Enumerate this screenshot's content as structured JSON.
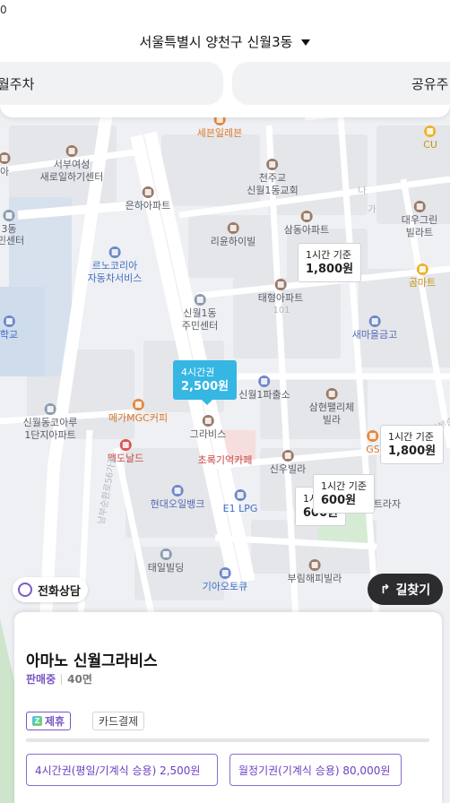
{
  "header": {
    "top_fragment": "0",
    "location": "서울특별시 양천구 신월3동",
    "chips": [
      "월주차",
      "공유주"
    ]
  },
  "map": {
    "pois": [
      {
        "name": "세븐일레븐",
        "style": "orange"
      },
      {
        "name": "CU",
        "style": "yellow"
      },
      {
        "name": "서부여성\n새로일하기센터",
        "style": "plain"
      },
      {
        "name": "천주교\n신월1동교회",
        "style": "plain"
      },
      {
        "name": "은하아파트",
        "style": "plain"
      },
      {
        "name": "삼동아파트",
        "style": "plain"
      },
      {
        "name": "대우그린\n빌라트",
        "style": "plain"
      },
      {
        "name": "리윤하이빌",
        "style": "plain"
      },
      {
        "name": "르노코리아\n자동차서비스",
        "style": "blue"
      },
      {
        "name": "곰마트",
        "style": "yellow"
      },
      {
        "name": "태형아파트",
        "style": "plain"
      },
      {
        "name": "신월1동\n주민센터",
        "style": "plain"
      },
      {
        "name": "새마을금고",
        "style": "blue"
      },
      {
        "name": "신월1파출소",
        "style": "plain"
      },
      {
        "name": "메가MGC커피",
        "style": "orange"
      },
      {
        "name": "그라비스",
        "style": "plain"
      },
      {
        "name": "삼현팰리체\n빌라",
        "style": "plain"
      },
      {
        "name": "신월동코아루\n1단지아파트",
        "style": "plain"
      },
      {
        "name": "맥도날드",
        "style": "red"
      },
      {
        "name": "초록기억카페",
        "style": "red"
      },
      {
        "name": "신우빌라",
        "style": "plain"
      },
      {
        "name": "현대오일뱅크",
        "style": "purple"
      },
      {
        "name": "E1 LPG",
        "style": "blue"
      },
      {
        "name": "태일빌딩",
        "style": "plain"
      },
      {
        "name": "기아오토큐",
        "style": "blue"
      },
      {
        "name": "부림해피빌라",
        "style": "plain"
      },
      {
        "name": "3동",
        "style": "plain"
      },
      {
        "name": "민센터",
        "style": "plain"
      },
      {
        "name": "학교",
        "style": "blue"
      },
      {
        "name": "아",
        "style": "plain"
      },
      {
        "name": "GS",
        "style": "orange"
      },
      {
        "name": "트라자",
        "style": "plain"
      },
      {
        "name": "101",
        "style": "light"
      },
      {
        "name": "나",
        "style": "light"
      },
      {
        "name": "가",
        "style": "light"
      },
      {
        "name": "남부순환로56가길",
        "style": "light"
      },
      {
        "name": "남부순환로57가길",
        "style": "light"
      }
    ],
    "price_tips": [
      {
        "label": "1시간 기준",
        "price": "1,800원",
        "active": false
      },
      {
        "label": "4시간권",
        "price": "2,500원",
        "active": true
      },
      {
        "label": "1시간 기준",
        "price": "1,800원",
        "active": false
      },
      {
        "label": "1시간 기준",
        "price": "600원",
        "active": false
      },
      {
        "label": "1시",
        "price": "600원",
        "active": false
      }
    ]
  },
  "actions": {
    "call_label": "전화상담",
    "directions_label": "길찾기"
  },
  "card": {
    "name": "아마노 신월그라비스",
    "status": "판매중",
    "spaces": "40면",
    "tags": [
      "제휴",
      "카드결제"
    ],
    "partner_badge": "Z",
    "tickets": [
      "4시간권(평일/기계식 승용) 2,500원",
      "월정기권(기계식 승용) 80,000원"
    ]
  },
  "colors": {
    "accent_purple": "#7a55c4",
    "active_tip": "#35b6e3",
    "dark_button": "#2c2c2e"
  }
}
